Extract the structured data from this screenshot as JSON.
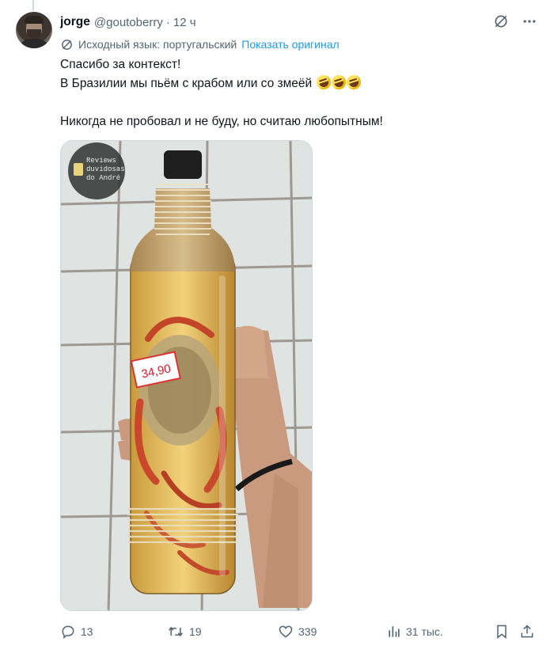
{
  "tweet": {
    "author_name": "jorge",
    "author_handle": "@goutoberry",
    "separator": "·",
    "time": "12 ч",
    "translation_notice": "Исходный язык: португальский",
    "show_original_label": "Показать оригинал",
    "lines": [
      "Спасибо за контекст!",
      "В Бразилии мы пьём с крабом или со змеёй",
      "Никогда не пробовал и не буду, но считаю любопытным!"
    ],
    "emoji": [
      "rolling-on-floor-laughing",
      "rolling-on-floor-laughing",
      "rolling-on-floor-laughing"
    ]
  },
  "media": {
    "watermark_lines": [
      "Reviews",
      "duvidosas",
      "do André"
    ],
    "price_tag": "34,90"
  },
  "actions": {
    "replies": "13",
    "reposts": "19",
    "likes": "339",
    "views": "31 тыс."
  },
  "icons": {
    "translate": "translate-icon",
    "more": "more-icon",
    "reply": "reply-icon",
    "repost": "repost-icon",
    "like": "heart-icon",
    "views": "views-icon",
    "bookmark": "bookmark-icon",
    "share": "share-icon"
  },
  "colors": {
    "text": "#0f1419",
    "secondary": "#536471",
    "link": "#1d9bf0",
    "border": "#cfd9de"
  }
}
